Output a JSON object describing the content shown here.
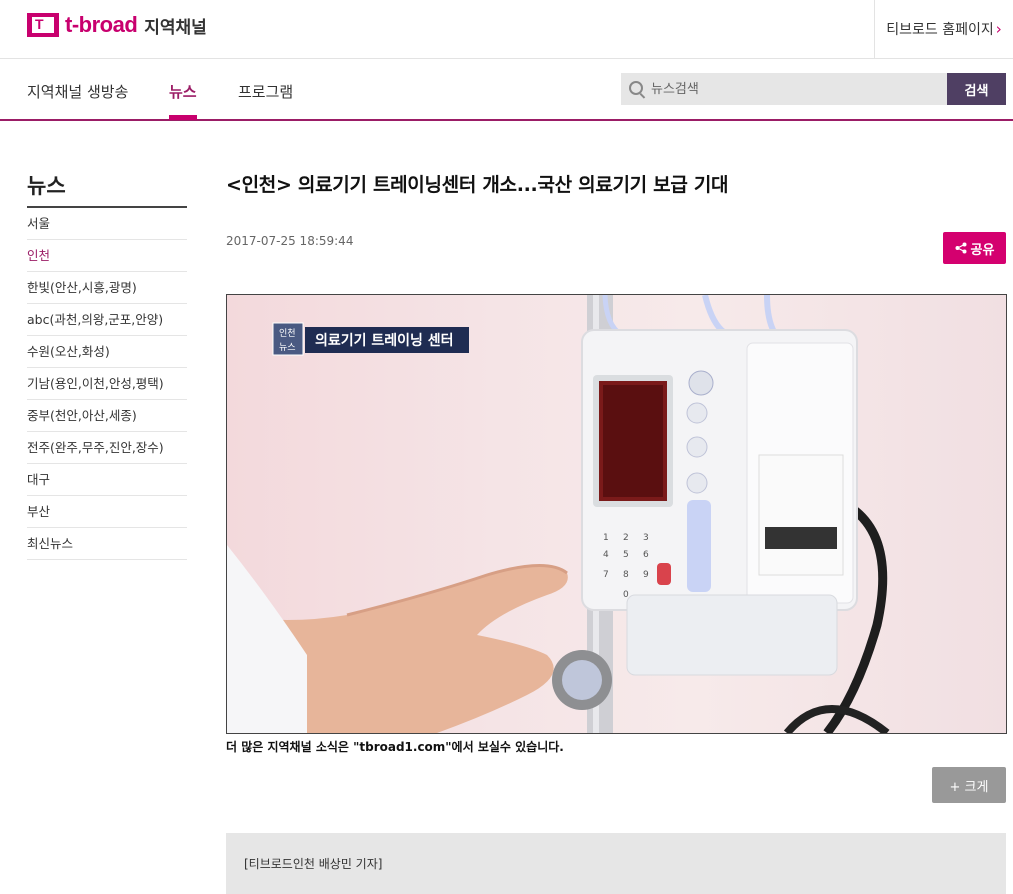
{
  "header": {
    "logo_mark": "T",
    "logo_text": "t-broad",
    "logo_sub": "지역채널",
    "home_link": "티브로드 홈페이지"
  },
  "nav": {
    "items": [
      {
        "label": "지역채널 생방송",
        "active": false
      },
      {
        "label": "뉴스",
        "active": true
      },
      {
        "label": "프로그램",
        "active": false
      }
    ],
    "search_placeholder": "뉴스검색",
    "search_button": "검색"
  },
  "sidebar": {
    "title": "뉴스",
    "items": [
      {
        "label": "서울",
        "active": false
      },
      {
        "label": "인천",
        "active": true
      },
      {
        "label": "한빛(안산,시흥,광명)",
        "active": false
      },
      {
        "label": "abc(과천,의왕,군포,안양)",
        "active": false
      },
      {
        "label": "수원(오산,화성)",
        "active": false
      },
      {
        "label": "기남(용인,이천,안성,평택)",
        "active": false
      },
      {
        "label": "중부(천안,아산,세종)",
        "active": false
      },
      {
        "label": "전주(완주,무주,진안,장수)",
        "active": false
      },
      {
        "label": "대구",
        "active": false
      },
      {
        "label": "부산",
        "active": false
      },
      {
        "label": "최신뉴스",
        "active": false
      }
    ]
  },
  "article": {
    "title": "<인천> 의료기기 트레이닝센터 개소...국산 의료기기 보급 기대",
    "date": "2017-07-25 18:59:44",
    "share_label": "공유",
    "video": {
      "badge_top": "인천",
      "badge_bottom": "뉴스",
      "caption_overlay": "의료기기 트레이닝 센터",
      "keypad_keys": [
        "1",
        "2",
        "3",
        "4",
        "5",
        "6",
        "7",
        "8",
        "9",
        "0"
      ]
    },
    "footer_caption": "더 많은 지역채널 소식은 \"tbroad1.com\"에서 보실수 있습니다.",
    "enlarge_label": "+ 크게",
    "reporter": "[티브로드인천 배상민 기자]"
  },
  "colors": {
    "brand": "#c8006e",
    "nav_active": "#9b1d66",
    "search_button": "#4f3f63",
    "share_button": "#d4006f",
    "enlarge_button": "#999999"
  }
}
